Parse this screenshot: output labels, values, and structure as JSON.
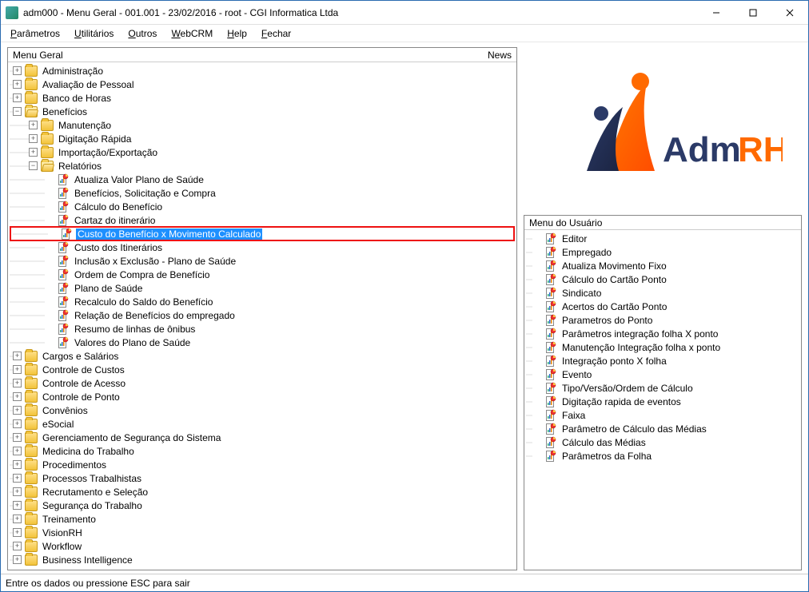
{
  "window": {
    "title": "adm000 - Menu Geral - 001.001 - 23/02/2016 - root - CGI Informatica Ltda"
  },
  "menubar": {
    "parametros": "Parâmetros",
    "utilitarios": "Utilitários",
    "outros": "Outros",
    "webcrm": "WebCRM",
    "help": "Help",
    "fechar": "Fechar"
  },
  "left_panel": {
    "title": "Menu Geral",
    "news": "News",
    "tree": [
      {
        "level": 0,
        "exp": "+",
        "icon": "folder",
        "label": "Administração"
      },
      {
        "level": 0,
        "exp": "+",
        "icon": "folder",
        "label": "Avaliação de Pessoal"
      },
      {
        "level": 0,
        "exp": "+",
        "icon": "folder",
        "label": "Banco de Horas"
      },
      {
        "level": 0,
        "exp": "-",
        "icon": "folder-open",
        "label": "Benefícios"
      },
      {
        "level": 1,
        "exp": "+",
        "icon": "folder",
        "label": "Manutenção"
      },
      {
        "level": 1,
        "exp": "+",
        "icon": "folder",
        "label": "Digitação Rápida"
      },
      {
        "level": 1,
        "exp": "+",
        "icon": "folder",
        "label": "Importação/Exportação"
      },
      {
        "level": 1,
        "exp": "-",
        "icon": "folder-open",
        "label": "Relatórios"
      },
      {
        "level": 2,
        "exp": "",
        "icon": "report",
        "label": "Atualiza Valor Plano de Saúde"
      },
      {
        "level": 2,
        "exp": "",
        "icon": "report",
        "label": "Benefícios, Solicitação e Compra"
      },
      {
        "level": 2,
        "exp": "",
        "icon": "report",
        "label": "Cálculo do Benefício"
      },
      {
        "level": 2,
        "exp": "",
        "icon": "report",
        "label": "Cartaz do itinerário"
      },
      {
        "level": 2,
        "exp": "",
        "icon": "report",
        "label": "Custo do Benefício x Movimento Calculado",
        "selected": true,
        "boxed": true
      },
      {
        "level": 2,
        "exp": "",
        "icon": "report",
        "label": "Custo dos Itinerários"
      },
      {
        "level": 2,
        "exp": "",
        "icon": "report",
        "label": "Inclusão x Exclusão - Plano de Saúde"
      },
      {
        "level": 2,
        "exp": "",
        "icon": "report",
        "label": "Ordem de Compra de Benefício"
      },
      {
        "level": 2,
        "exp": "",
        "icon": "report",
        "label": "Plano de Saúde"
      },
      {
        "level": 2,
        "exp": "",
        "icon": "report",
        "label": "Recalculo do Saldo do Benefício"
      },
      {
        "level": 2,
        "exp": "",
        "icon": "report",
        "label": "Relação de Benefícios do empregado"
      },
      {
        "level": 2,
        "exp": "",
        "icon": "report",
        "label": "Resumo de linhas de ônibus"
      },
      {
        "level": 2,
        "exp": "",
        "icon": "report",
        "label": "Valores do Plano de Saúde"
      },
      {
        "level": 0,
        "exp": "+",
        "icon": "folder",
        "label": "Cargos e Salários"
      },
      {
        "level": 0,
        "exp": "+",
        "icon": "folder",
        "label": "Controle de Custos"
      },
      {
        "level": 0,
        "exp": "+",
        "icon": "folder",
        "label": "Controle de Acesso"
      },
      {
        "level": 0,
        "exp": "+",
        "icon": "folder",
        "label": "Controle de Ponto"
      },
      {
        "level": 0,
        "exp": "+",
        "icon": "folder",
        "label": "Convênios"
      },
      {
        "level": 0,
        "exp": "+",
        "icon": "folder",
        "label": "eSocial"
      },
      {
        "level": 0,
        "exp": "+",
        "icon": "folder",
        "label": "Gerenciamento de Segurança do Sistema"
      },
      {
        "level": 0,
        "exp": "+",
        "icon": "folder",
        "label": "Medicina do Trabalho"
      },
      {
        "level": 0,
        "exp": "+",
        "icon": "folder",
        "label": "Procedimentos"
      },
      {
        "level": 0,
        "exp": "+",
        "icon": "folder",
        "label": "Processos Trabalhistas"
      },
      {
        "level": 0,
        "exp": "+",
        "icon": "folder",
        "label": "Recrutamento e Seleção"
      },
      {
        "level": 0,
        "exp": "+",
        "icon": "folder",
        "label": "Segurança do Trabalho"
      },
      {
        "level": 0,
        "exp": "+",
        "icon": "folder",
        "label": "Treinamento"
      },
      {
        "level": 0,
        "exp": "+",
        "icon": "folder",
        "label": "VisionRH"
      },
      {
        "level": 0,
        "exp": "+",
        "icon": "folder",
        "label": "Workflow"
      },
      {
        "level": 0,
        "exp": "+",
        "icon": "folder",
        "label": "Business Intelligence"
      }
    ]
  },
  "user_panel": {
    "title": "Menu do Usuário",
    "items": [
      "Editor",
      "Empregado",
      "Atualiza Movimento Fixo",
      "Cálculo do Cartão Ponto",
      "Sindicato",
      "Acertos do Cartão Ponto",
      "Parametros do Ponto",
      "Parâmetros integração folha X ponto",
      "Manutenção Integração folha x ponto",
      "Integração ponto X folha",
      "Evento",
      "Tipo/Versão/Ordem de Cálculo",
      "Digitação rapida de eventos",
      "Faixa",
      "Parâmetro de Cálculo das Médias",
      "Cálculo das Médias",
      "Parâmetros da Folha"
    ]
  },
  "logo": {
    "text1": "Adm",
    "text2": "RH"
  },
  "status": {
    "text": "Entre os dados ou pressione ESC para sair"
  }
}
